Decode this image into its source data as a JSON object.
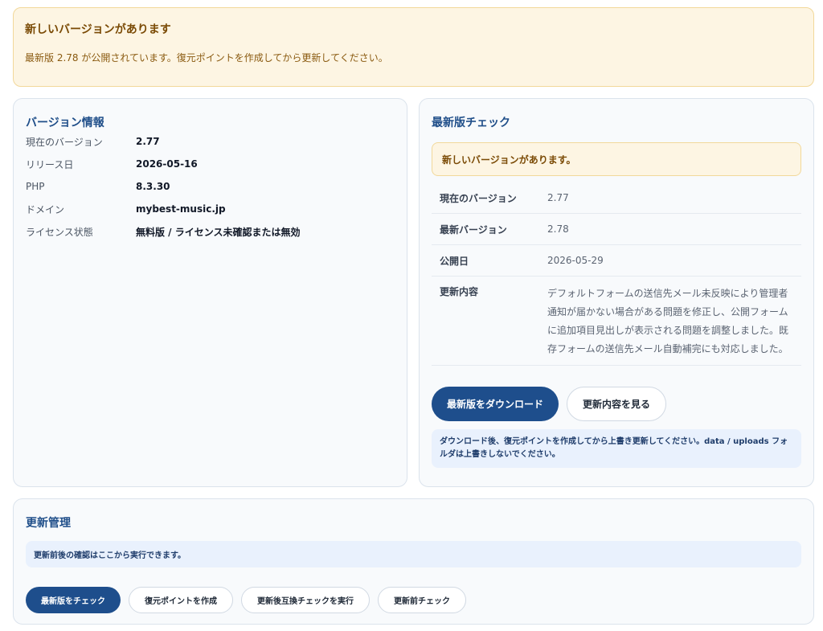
{
  "banner": {
    "title": "新しいバージョンがあります",
    "text": "最新版 2.78 が公開されています。復元ポイントを作成してから更新してください。"
  },
  "version_info": {
    "title": "バージョン情報",
    "rows": [
      {
        "label": "現在のバージョン",
        "value": "2.77"
      },
      {
        "label": "リリース日",
        "value": "2026-05-16"
      },
      {
        "label": "PHP",
        "value": "8.3.30"
      },
      {
        "label": "ドメイン",
        "value": "mybest-music.jp"
      },
      {
        "label": "ライセンス状態",
        "value": "無料版 / ライセンス未確認または無効"
      }
    ]
  },
  "latest_check": {
    "title": "最新版チェック",
    "alert": "新しいバージョンがあります。",
    "rows": [
      {
        "label": "現在のバージョン",
        "value": "2.77"
      },
      {
        "label": "最新バージョン",
        "value": "2.78"
      },
      {
        "label": "公開日",
        "value": "2026-05-29"
      },
      {
        "label": "更新内容",
        "value": "デフォルトフォームの送信先メール未反映により管理者通知が届かない場合がある問題を修正し、公開フォームに追加項目見出しが表示される問題を調整しました。既存フォームの送信先メール自動補完にも対応しました。"
      }
    ],
    "download_label": "最新版をダウンロード",
    "changelog_label": "更新内容を見る",
    "note": "ダウンロード後、復元ポイントを作成してから上書き更新してください。data / uploads フォルダは上書きしないでください。"
  },
  "update_management": {
    "title": "更新管理",
    "note": "更新前後の確認はここから実行できます。",
    "buttons": {
      "check_latest": "最新版をチェック",
      "create_restore": "復元ポイントを作成",
      "post_check": "更新後互換チェックを実行",
      "pre_check": "更新前チェック"
    }
  },
  "colors": {
    "accent": "#1e4e8c",
    "warning_bg": "#fdf5e3",
    "warning_border": "#f2d89a",
    "info_bg": "#e9f1fd"
  }
}
